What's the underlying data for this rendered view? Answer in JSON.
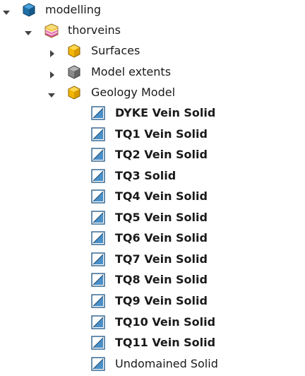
{
  "tree": {
    "root": {
      "label": "modelling",
      "icon": "cube-blue-icon",
      "expanded": true
    },
    "project": {
      "label": "thorveins",
      "icon": "layers-stack-icon",
      "expanded": true
    },
    "folders": [
      {
        "label": "Surfaces",
        "icon": "folder-cube-yellow-icon",
        "expanded": false
      },
      {
        "label": "Model extents",
        "icon": "cube-gray-icon",
        "expanded": false
      },
      {
        "label": "Geology Model",
        "icon": "folder-cube-yellow-icon",
        "expanded": true
      }
    ],
    "solids": [
      {
        "label": "DYKE Vein Solid",
        "icon": "solid-triangle-icon",
        "bold": true
      },
      {
        "label": "TQ1 Vein Solid",
        "icon": "solid-triangle-icon",
        "bold": true
      },
      {
        "label": "TQ2 Vein Solid",
        "icon": "solid-triangle-icon",
        "bold": true
      },
      {
        "label": "TQ3 Solid",
        "icon": "solid-triangle-icon",
        "bold": true
      },
      {
        "label": "TQ4 Vein Solid",
        "icon": "solid-triangle-icon",
        "bold": true
      },
      {
        "label": "TQ5 Vein Solid",
        "icon": "solid-triangle-icon",
        "bold": true
      },
      {
        "label": "TQ6 Vein Solid",
        "icon": "solid-triangle-icon",
        "bold": true
      },
      {
        "label": "TQ7 Vein Solid",
        "icon": "solid-triangle-icon",
        "bold": true
      },
      {
        "label": "TQ8 Vein Solid",
        "icon": "solid-triangle-icon",
        "bold": true
      },
      {
        "label": "TQ9 Vein Solid",
        "icon": "solid-triangle-icon",
        "bold": true
      },
      {
        "label": "TQ10 Vein Solid",
        "icon": "solid-triangle-icon",
        "bold": true
      },
      {
        "label": "TQ11 Vein Solid",
        "icon": "solid-triangle-icon",
        "bold": true
      },
      {
        "label": "Undomained Solid",
        "icon": "solid-triangle-icon",
        "bold": false
      }
    ]
  }
}
